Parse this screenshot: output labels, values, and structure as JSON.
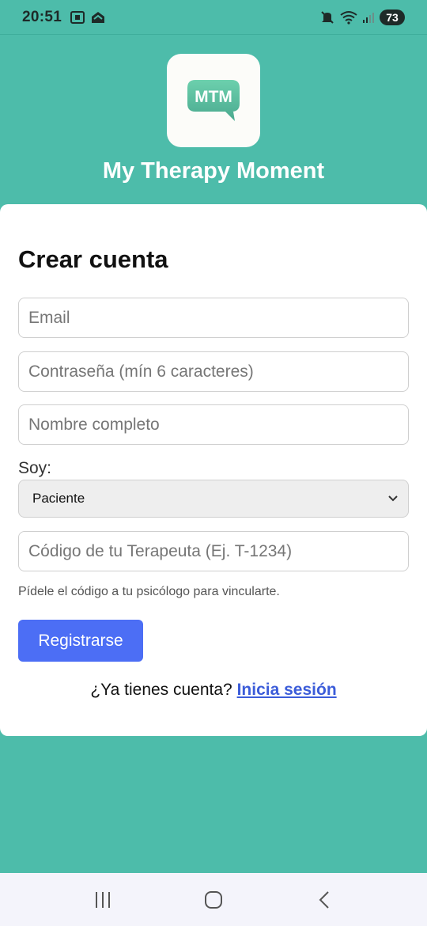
{
  "status_bar": {
    "time": "20:51",
    "battery": "73",
    "icons": [
      "screenshot-icon",
      "cloud-app-icon",
      "mute-icon",
      "wifi-icon",
      "signal-icon"
    ]
  },
  "header": {
    "logo_text": "MTM",
    "app_title": "My Therapy Moment",
    "logo_color": "#5fc2a4"
  },
  "form": {
    "title": "Crear cuenta",
    "email_placeholder": "Email",
    "password_placeholder": "Contraseña (mín 6 caracteres)",
    "name_placeholder": "Nombre completo",
    "role_label": "Soy:",
    "role_selected": "Paciente",
    "therapist_code_placeholder": "Código de tu Terapeuta (Ej. T-1234)",
    "hint": "Pídele el código a tu psicólogo para vincularte.",
    "register_label": "Registrarse",
    "login_prompt": "¿Ya tienes cuenta?",
    "login_link": "Inicia sesión"
  },
  "colors": {
    "background": "#4dbcaa",
    "primary_button": "#4c6ef5",
    "link": "#3b5cd9"
  },
  "nav_bar": {
    "icons": [
      "recent-apps-icon",
      "home-icon",
      "back-icon"
    ]
  }
}
